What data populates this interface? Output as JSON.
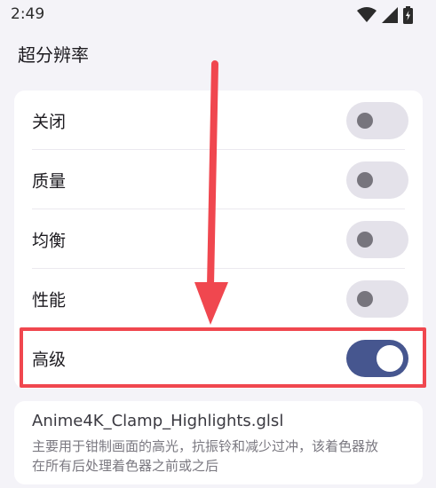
{
  "status_bar": {
    "time": "2:49",
    "icons": [
      "wifi-icon",
      "cellular-signal-icon",
      "battery-charging-icon"
    ]
  },
  "section_title": "超分辨率",
  "options": [
    {
      "label": "关闭",
      "enabled": false
    },
    {
      "label": "质量",
      "enabled": false
    },
    {
      "label": "均衡",
      "enabled": false
    },
    {
      "label": "性能",
      "enabled": false
    },
    {
      "label": "高级",
      "enabled": true
    }
  ],
  "info": {
    "title": "Anime4K_Clamp_Highlights.glsl",
    "description": "主要用于钳制画面的高光，抗振铃和减少过冲，该着色器放在所有后处理着色器之前或之后"
  },
  "colors": {
    "accent": "#46568f",
    "annotation": "#f0474f"
  }
}
